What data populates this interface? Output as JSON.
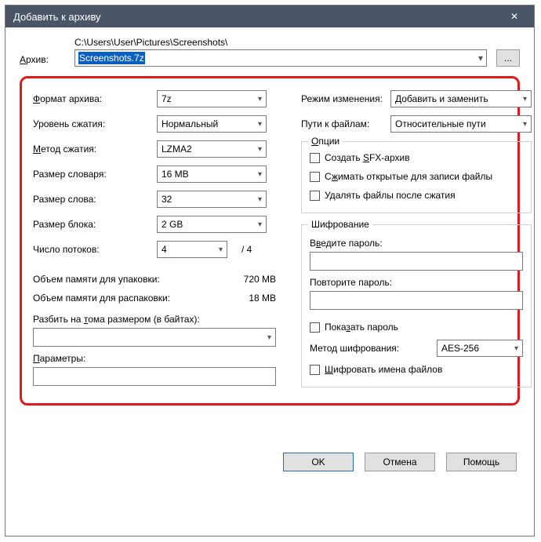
{
  "titlebar": {
    "title": "Добавить к архиву"
  },
  "archive": {
    "label": "Архив:",
    "path": "C:\\Users\\User\\Pictures\\Screenshots\\",
    "filename": "Screenshots.7z",
    "browse": "..."
  },
  "left": {
    "format_label": "Формат архива:",
    "format_value": "7z",
    "level_label": "Уровень сжатия:",
    "level_value": "Нормальный",
    "method_label": "Метод сжатия:",
    "method_value": "LZMA2",
    "dict_label": "Размер словаря:",
    "dict_value": "16 MB",
    "word_label": "Размер слова:",
    "word_value": "32",
    "block_label": "Размер блока:",
    "block_value": "2 GB",
    "threads_label": "Число потоков:",
    "threads_value": "4",
    "threads_of": "/ 4",
    "mem_pack_label": "Объем памяти для упаковки:",
    "mem_pack_value": "720 MB",
    "mem_unpack_label": "Объем памяти для распаковки:",
    "mem_unpack_value": "18 MB",
    "split_label": "Разбить на тома размером (в байтах):",
    "split_value": "",
    "params_label": "Параметры:",
    "params_value": ""
  },
  "right": {
    "mode_label": "Режим изменения:",
    "mode_value": "Добавить и заменить",
    "paths_label": "Пути к файлам:",
    "paths_value": "Относительные пути",
    "options_legend": "Опции",
    "sfx_label": "Создать SFX-архив",
    "compress_open_label": "Сжимать открытые для записи файлы",
    "delete_after_label": "Удалять файлы после сжатия",
    "encryption_legend": "Шифрование",
    "pass1_label": "Введите пароль:",
    "pass1_value": "",
    "pass2_label": "Повторите пароль:",
    "pass2_value": "",
    "show_pass_label": "Показать пароль",
    "enc_method_label": "Метод шифрования:",
    "enc_method_value": "AES-256",
    "enc_names_label": "Шифровать имена файлов"
  },
  "buttons": {
    "ok": "OK",
    "cancel": "Отмена",
    "help": "Помощь"
  }
}
